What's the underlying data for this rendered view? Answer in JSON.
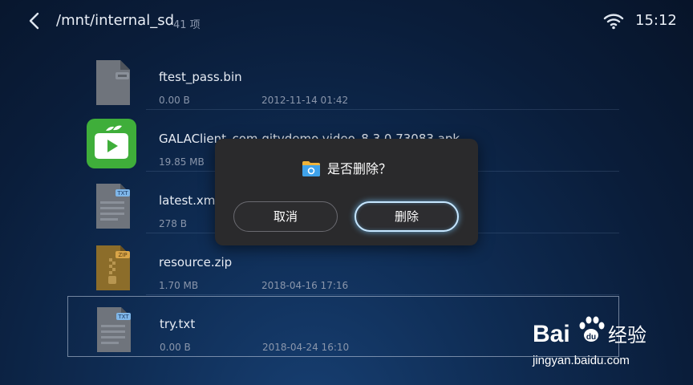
{
  "header": {
    "path": "/mnt/internal_sd",
    "item_count": "41 项",
    "time": "15:12"
  },
  "icons": {
    "back": "back-arrow-icon",
    "wifi": "wifi-icon",
    "dialog": "folder-icon"
  },
  "files": [
    {
      "name": "ftest_pass.bin",
      "size": "0.00 B",
      "date": "2012-11-14 01:42",
      "icon": "bin-file-icon",
      "badge": ""
    },
    {
      "name": "GALAClient_com.gitvdemo.video_8.3.0.73083.apk",
      "size": "19.85 MB",
      "date": "",
      "icon": "app-icon",
      "badge": ""
    },
    {
      "name": "latest.xml",
      "size": "278 B",
      "date": "",
      "icon": "txt-file-icon",
      "badge": "TXT"
    },
    {
      "name": "resource.zip",
      "size": "1.70 MB",
      "date": "2018-04-16 17:16",
      "icon": "zip-file-icon",
      "badge": "ZIP"
    },
    {
      "name": "try.txt",
      "size": "0.00 B",
      "date": "2018-04-24 16:10",
      "icon": "txt-file-icon",
      "badge": "TXT"
    }
  ],
  "dialog": {
    "title": "是否删除？",
    "cancel_label": "取消",
    "confirm_label": "删除"
  },
  "watermark": {
    "brand_prefix": "Bai",
    "brand_suffix": "经验",
    "url": "jingyan.baidu.com"
  },
  "colors": {
    "background": "#0d2548",
    "dialog": "#2a2a2c",
    "focus_glow": "#c6e6ff",
    "app_green": "#3fae3a"
  }
}
